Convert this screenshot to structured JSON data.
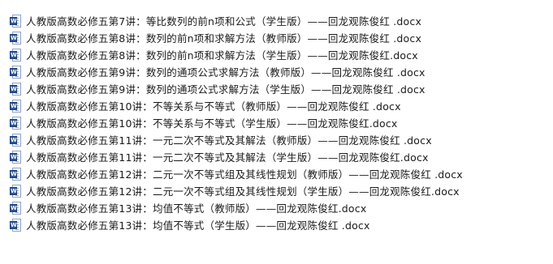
{
  "icon": "word-document-icon",
  "icon_badge": "W",
  "files": [
    {
      "name": "人教版高数必修五第7讲：等比数列的前n项和公式（学生版）——回龙观陈俊红 .docx"
    },
    {
      "name": "人教版高数必修五第8讲：数列的前n项和求解方法（教师版）——回龙观陈俊红 .docx"
    },
    {
      "name": "人教版高数必修五第8讲：数列的前n项和求解方法（学生版）——回龙观陈俊红.docx"
    },
    {
      "name": "人教版高数必修五第9讲：数列的通项公式求解方法（教师版）——回龙观陈俊红 .docx"
    },
    {
      "name": "人教版高数必修五第9讲：数列的通项公式求解方法（学生版）——回龙观陈俊红 .docx"
    },
    {
      "name": "人教版高数必修五第10讲：不等关系与不等式（教师版）——回龙观陈俊红 .docx"
    },
    {
      "name": "人教版高数必修五第10讲：不等关系与不等式（学生版）——回龙观陈俊红.docx"
    },
    {
      "name": "人教版高数必修五第11讲：一元二次不等式及其解法（教师版）——回龙观陈俊红 .docx"
    },
    {
      "name": "人教版高数必修五第11讲：一元二次不等式及其解法（学生版）——回龙观陈俊红.docx"
    },
    {
      "name": "人教版高数必修五第12讲：二元一次不等式组及其线性规划（教师版）——回龙观陈俊红 .docx"
    },
    {
      "name": "人教版高数必修五第12讲：二元一次不等式组及其线性规划（学生版）——回龙观陈俊红.docx"
    },
    {
      "name": "人教版高数必修五第13讲：均值不等式（教师版）——回龙观陈俊红.docx"
    },
    {
      "name": "人教版高数必修五第13讲：均值不等式（学生版）——回龙观陈俊红 .docx"
    }
  ]
}
